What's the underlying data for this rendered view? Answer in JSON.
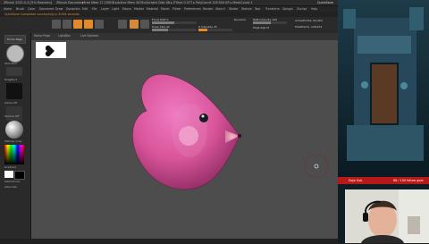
{
  "titlebar": {
    "app_title": "ZBrush 2022.0.4 [Trin Rueuben]",
    "doc_title": "ZBrush Document",
    "stats": "▸Free Mem 17.109GB ▸Active Mem 3476 ▸Scratch Disk 48 ▸ ZTime 0.377 ▸ PolyCount 128.904 KP ▸ MeshCount 1",
    "quicksave": "QuickSave"
  },
  "menubar": {
    "items": [
      "Alpha",
      "Brush",
      "Color",
      "Document",
      "Draw",
      "Dynamics",
      "Edit",
      "File",
      "Layer",
      "Light",
      "Macro",
      "Marker",
      "Material",
      "Movie",
      "Picker",
      "Preferences",
      "Render",
      "Stencil",
      "Stroke",
      "Texture",
      "Tool",
      "Transform",
      "Zplugin",
      "Zscript",
      "Help"
    ]
  },
  "notice": {
    "text": "QuickSave Completed successfully in 8.994 seconds"
  },
  "toolbar": {
    "draw_size_label": "Draw Size 42",
    "dynamic_label": "Dynamic",
    "focal_shift_label": "Focal Shift 0",
    "z_intensity_label": "Z Intensity 25",
    "rgb_intensity_label": "RGB Intensity 100",
    "mrgb_label": "Mrgb  Rgb  M",
    "active_points_label": "ActivePoints: 64,450",
    "total_points_label": "TotalPoints: 128,872"
  },
  "leftpanel": {
    "home_page": "Home Page",
    "lightbox": "LightBox",
    "live_boolean": "Live Boolean",
    "brush_label": "Standard",
    "stroke_label": "DragRect",
    "alpha_label": "Alpha Off",
    "texture_label": "Texture Off",
    "material_label": "MatCap Gray",
    "gradient_label": "Gradient",
    "switch_color": "SwitchColor",
    "alternate": "Alternate"
  },
  "overlay": {
    "left_text": "Dojo Sub",
    "right_text": "88 / 100  follow goal"
  },
  "colors": {
    "accent": "#e08a2b",
    "heart": "#d9559a",
    "overlay_red": "#b71818",
    "canvas_bg": "#4d4d4d"
  }
}
